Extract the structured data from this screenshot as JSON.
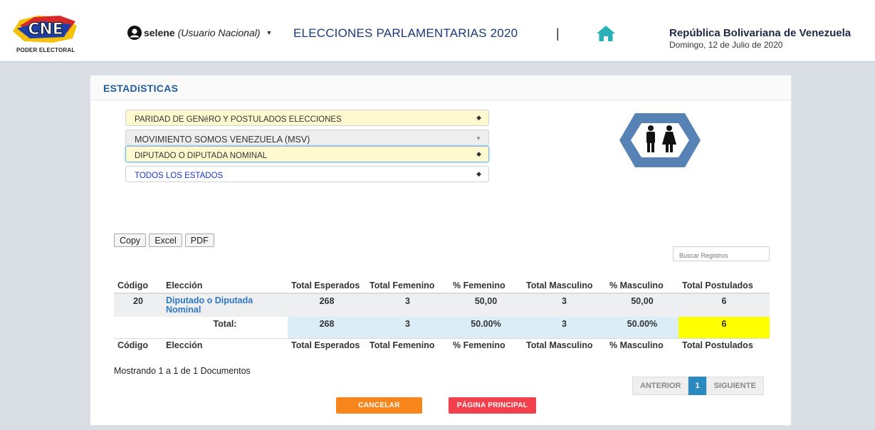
{
  "header": {
    "logo_text": "CNE",
    "logo_sub": "PODER ELECTORAL",
    "user_name": "selene",
    "user_role": "(Usuario Nacional)",
    "app_title": "ELECCIONES PARLAMENTARIAS 2020",
    "separator": "|",
    "country": "República Bolivariana de Venezuela",
    "date": "Domingo, 12 de Julio de 2020"
  },
  "card": {
    "title": "ESTADíSTICAS",
    "selects": [
      "PARIDAD DE GENéRO Y POSTULADOS ELECCIONES",
      "MOVIMIENTO SOMOS VENEZUELA (MSV)",
      "DIPUTADO O DIPUTADA NOMINAL",
      "TODOS LOS ESTADOS"
    ]
  },
  "export": {
    "copy": "Copy",
    "excel": "Excel",
    "pdf": "PDF"
  },
  "search": {
    "placeholder": "Buscar Registros"
  },
  "table": {
    "headers": [
      "Código",
      "Elección",
      "Total Esperados",
      "Total Femenino",
      "% Femenino",
      "Total Masculino",
      "% Masculino",
      "Total Postulados"
    ],
    "row": [
      "20",
      "Diputado o Diputada Nominal",
      "268",
      "3",
      "50,00",
      "3",
      "50,00",
      "6"
    ],
    "total_row": [
      "",
      "Total:",
      "268",
      "3",
      "50.00%",
      "3",
      "50.00%",
      "6"
    ]
  },
  "footer": {
    "showing": "Mostrando 1 a 1 de 1 Documentos",
    "prev": "ANTERIOR",
    "page": "1",
    "next": "SIGUIENTE",
    "cancel": "CANCELAR",
    "main_page": "PÁGINA PRINCIPAL"
  },
  "colors": {
    "brand_blue": "#1c3a7a",
    "accent_orange": "#f7861c",
    "accent_red": "#f2404c",
    "highlight_yellow": "#ffff00"
  }
}
